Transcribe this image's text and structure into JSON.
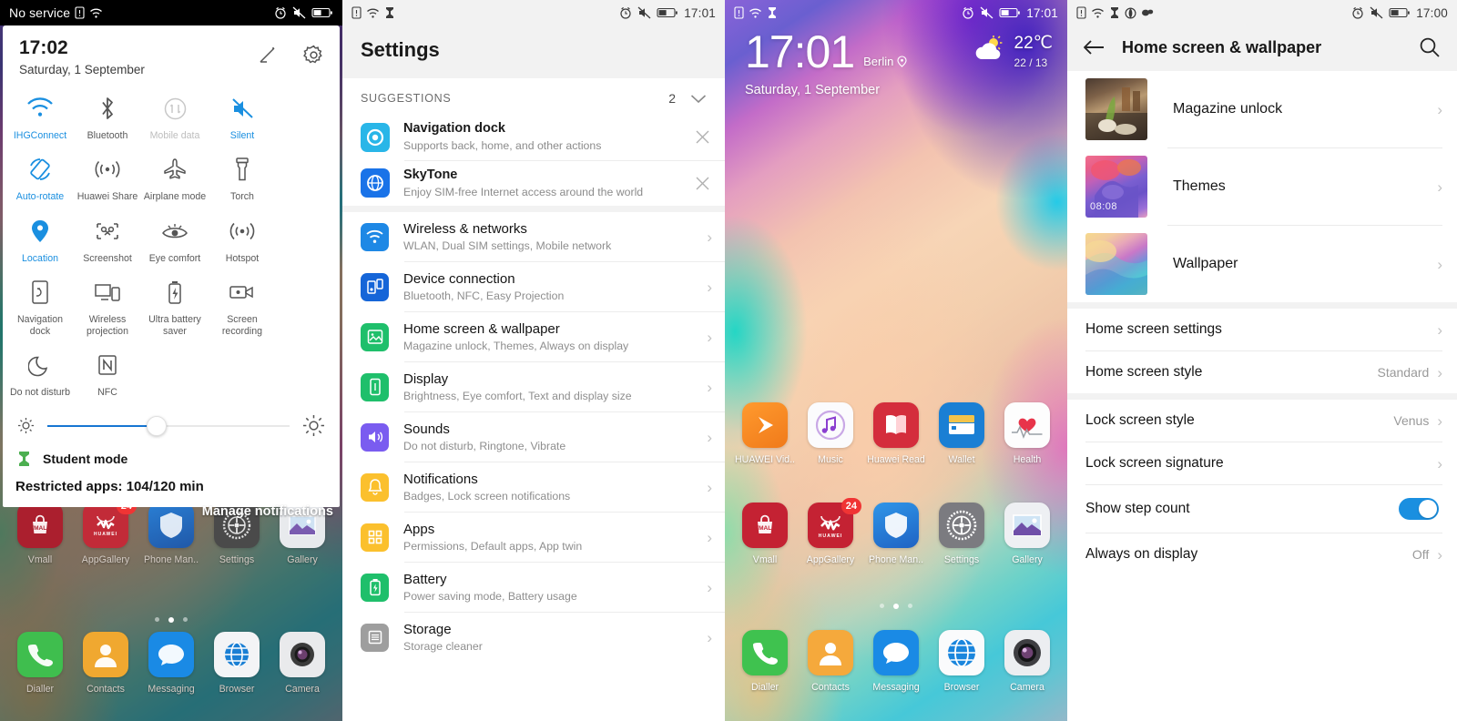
{
  "panel1": {
    "statusbar": {
      "carrier": "No service",
      "icons_left": [
        "sim-card-icon",
        "wifi-icon"
      ],
      "icons_right": [
        "alarm-icon",
        "mute-icon",
        "battery-icon"
      ]
    },
    "quick_settings": {
      "time": "17:02",
      "date": "Saturday, 1 September",
      "edit_label": "edit-icon",
      "settings_label": "gear-icon",
      "tiles": [
        {
          "label": "IHGConnect",
          "icon": "wifi-icon",
          "state": "on"
        },
        {
          "label": "Bluetooth",
          "icon": "bluetooth-icon",
          "state": "normal"
        },
        {
          "label": "Mobile data",
          "icon": "mobile-data-icon",
          "state": "off"
        },
        {
          "label": "Silent",
          "icon": "silent-icon",
          "state": "on"
        },
        {
          "label": "Auto-rotate",
          "icon": "auto-rotate-icon",
          "state": "on"
        },
        {
          "label": "Huawei Share",
          "icon": "huawei-share-icon",
          "state": "normal"
        },
        {
          "label": "Airplane mode",
          "icon": "airplane-icon",
          "state": "normal"
        },
        {
          "label": "Torch",
          "icon": "torch-icon",
          "state": "normal"
        },
        {
          "label": "Location",
          "icon": "location-pin-icon",
          "state": "on"
        },
        {
          "label": "Screenshot",
          "icon": "screenshot-icon",
          "state": "normal"
        },
        {
          "label": "Eye comfort",
          "icon": "eye-comfort-icon",
          "state": "normal"
        },
        {
          "label": "Hotspot",
          "icon": "hotspot-icon",
          "state": "normal"
        },
        {
          "label": "Navigation dock",
          "icon": "navigation-dock-icon",
          "state": "normal"
        },
        {
          "label": "Wireless projection",
          "icon": "wireless-projection-icon",
          "state": "normal"
        },
        {
          "label": "Ultra battery saver",
          "icon": "ultra-battery-saver-icon",
          "state": "normal"
        },
        {
          "label": "Screen recording",
          "icon": "screen-recording-icon",
          "state": "normal"
        },
        {
          "label": "Do not disturb",
          "icon": "moon-icon",
          "state": "normal"
        },
        {
          "label": "NFC",
          "icon": "nfc-icon",
          "state": "normal"
        }
      ],
      "brightness_percent": 45,
      "brightness_low_icon": "brightness-low-icon",
      "brightness_high_icon": "brightness-high-icon",
      "expand_icon": "chevron-up-icon"
    },
    "notification": {
      "app_icon": "student-mode-icon",
      "title": "Student mode",
      "body": "Restricted apps: 104/120 min"
    },
    "manage_notifications": "Manage notifications",
    "home_apps_row": [
      {
        "name": "Vmall",
        "icon": "vmall-icon"
      },
      {
        "name": "AppGallery",
        "icon": "appgallery-icon",
        "badge": "24"
      },
      {
        "name": "Phone Man..",
        "icon": "phone-manager-icon"
      },
      {
        "name": "Settings",
        "icon": "settings-gear-icon"
      },
      {
        "name": "Gallery",
        "icon": "gallery-icon"
      }
    ],
    "home_dock": [
      {
        "name": "Dialler",
        "icon": "phone-icon"
      },
      {
        "name": "Contacts",
        "icon": "contacts-icon"
      },
      {
        "name": "Messaging",
        "icon": "message-icon"
      },
      {
        "name": "Browser",
        "icon": "browser-globe-icon"
      },
      {
        "name": "Camera",
        "icon": "camera-icon"
      }
    ],
    "page_dots": {
      "count": 3,
      "active": 1
    }
  },
  "panel2": {
    "statusbar": {
      "time": "17:01",
      "icons_left": [
        "sim-card-icon",
        "wifi-icon",
        "student-mode-icon"
      ],
      "icons_right": [
        "alarm-icon",
        "mute-icon",
        "battery-icon"
      ]
    },
    "title": "Settings",
    "suggestions": {
      "header": "SUGGESTIONS",
      "count": "2",
      "collapse_icon": "chevron-down-icon",
      "items": [
        {
          "title": "Navigation dock",
          "subtitle": "Supports back, home, and other actions",
          "icon": "navigation-dock-app-icon",
          "color": "#29b6e8",
          "dismiss": "close-icon"
        },
        {
          "title": "SkyTone",
          "subtitle": "Enjoy SIM-free Internet access around the world",
          "icon": "skytone-icon",
          "color": "#1a73e8",
          "dismiss": "close-icon"
        }
      ]
    },
    "items": [
      {
        "title": "Wireless & networks",
        "subtitle": "WLAN, Dual SIM settings, Mobile network",
        "icon": "wifi-icon",
        "color": "#1e88e5"
      },
      {
        "title": "Device connection",
        "subtitle": "Bluetooth, NFC, Easy Projection",
        "icon": "device-connect-icon",
        "color": "#1565d8"
      },
      {
        "title": "Home screen & wallpaper",
        "subtitle": "Magazine unlock, Themes, Always on display",
        "icon": "wallpaper-icon",
        "color": "#1fbf6b"
      },
      {
        "title": "Display",
        "subtitle": "Brightness, Eye comfort, Text and display size",
        "icon": "display-icon",
        "color": "#1fbf6b"
      },
      {
        "title": "Sounds",
        "subtitle": "Do not disturb, Ringtone, Vibrate",
        "icon": "sound-icon",
        "color": "#7a5cf0"
      },
      {
        "title": "Notifications",
        "subtitle": "Badges, Lock screen notifications",
        "icon": "bell-icon",
        "color": "#fbc02d"
      },
      {
        "title": "Apps",
        "subtitle": "Permissions, Default apps, App twin",
        "icon": "apps-grid-icon",
        "color": "#fbc02d"
      },
      {
        "title": "Battery",
        "subtitle": "Power saving mode, Battery usage",
        "icon": "battery-icon",
        "color": "#1fbf6b"
      },
      {
        "title": "Storage",
        "subtitle": "Storage cleaner",
        "icon": "storage-icon",
        "color": "#9e9e9e"
      }
    ]
  },
  "panel3": {
    "statusbar": {
      "time": "17:01",
      "icons_left": [
        "sim-card-icon",
        "wifi-icon",
        "student-mode-icon"
      ],
      "icons_right": [
        "alarm-icon",
        "mute-icon",
        "battery-icon"
      ]
    },
    "clock": {
      "time": "17:01",
      "city": "Berlin",
      "location_icon": "location-pin-icon",
      "date": "Saturday, 1 September"
    },
    "weather": {
      "icon": "partly-cloudy-icon",
      "temperature": "22℃",
      "range": "22 / 13"
    },
    "apps_row1": [
      {
        "name": "HUAWEI Vid..",
        "icon": "huawei-video-icon"
      },
      {
        "name": "Music",
        "icon": "music-icon"
      },
      {
        "name": "Huawei Read",
        "icon": "huawei-read-icon"
      },
      {
        "name": "Wallet",
        "icon": "wallet-icon"
      },
      {
        "name": "Health",
        "icon": "health-icon"
      }
    ],
    "apps_row2": [
      {
        "name": "Vmall",
        "icon": "vmall-icon"
      },
      {
        "name": "AppGallery",
        "icon": "appgallery-icon",
        "badge": "24"
      },
      {
        "name": "Phone Man..",
        "icon": "phone-manager-icon"
      },
      {
        "name": "Settings",
        "icon": "settings-gear-icon"
      },
      {
        "name": "Gallery",
        "icon": "gallery-icon"
      }
    ],
    "dock": [
      {
        "name": "Dialler",
        "icon": "phone-icon"
      },
      {
        "name": "Contacts",
        "icon": "contacts-icon"
      },
      {
        "name": "Messaging",
        "icon": "message-icon"
      },
      {
        "name": "Browser",
        "icon": "browser-globe-icon"
      },
      {
        "name": "Camera",
        "icon": "camera-icon"
      }
    ],
    "page_dots": {
      "count": 3,
      "active": 1
    }
  },
  "panel4": {
    "statusbar": {
      "time": "17:00",
      "icons_left": [
        "sim-card-icon",
        "wifi-icon",
        "student-mode-icon",
        "app-icon",
        "app-icon"
      ],
      "icons_right": [
        "alarm-icon",
        "mute-icon",
        "battery-icon"
      ]
    },
    "back_icon": "back-arrow-icon",
    "title": "Home screen & wallpaper",
    "search_icon": "search-icon",
    "thumb_items": [
      {
        "label": "Magazine unlock",
        "thumb": "magazine-thumb"
      },
      {
        "label": "Themes",
        "thumb": "themes-thumb",
        "overlay_text": "08:08"
      },
      {
        "label": "Wallpaper",
        "thumb": "wallpaper-thumb"
      }
    ],
    "rows_group1": [
      {
        "label": "Home screen settings",
        "value": "",
        "type": "chevron"
      },
      {
        "label": "Home screen style",
        "value": "Standard",
        "type": "chevron"
      }
    ],
    "rows_group2": [
      {
        "label": "Lock screen style",
        "value": "Venus",
        "type": "chevron"
      },
      {
        "label": "Lock screen signature",
        "value": "",
        "type": "chevron"
      },
      {
        "label": "Show step count",
        "value": "",
        "type": "toggle",
        "toggle_on": true
      },
      {
        "label": "Always on display",
        "value": "Off",
        "type": "chevron"
      }
    ]
  },
  "colors": {
    "accent_blue": "#1a8fe0",
    "slider_blue": "#1676d2",
    "badge_red": "#f03434",
    "header_grey": "#f2f2f2"
  }
}
